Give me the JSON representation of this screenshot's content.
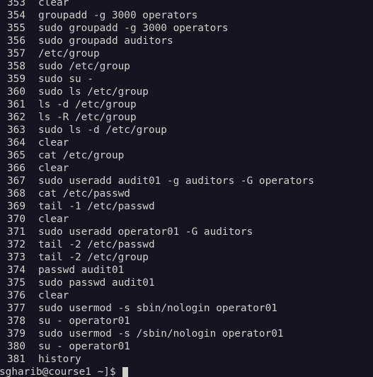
{
  "terminal": {
    "history": [
      {
        "num": "353",
        "cmd": "clear"
      },
      {
        "num": "354",
        "cmd": "groupadd -g 3000 operators"
      },
      {
        "num": "355",
        "cmd": "sudo groupadd -g 3000 operators"
      },
      {
        "num": "356",
        "cmd": "sudo groupadd auditors"
      },
      {
        "num": "357",
        "cmd": "/etc/group"
      },
      {
        "num": "358",
        "cmd": "sudo /etc/group"
      },
      {
        "num": "359",
        "cmd": "sudo su -"
      },
      {
        "num": "360",
        "cmd": "sudo ls /etc/group"
      },
      {
        "num": "361",
        "cmd": "ls -d /etc/group"
      },
      {
        "num": "362",
        "cmd": "ls -R /etc/group"
      },
      {
        "num": "363",
        "cmd": "sudo ls -d /etc/group"
      },
      {
        "num": "364",
        "cmd": "clear"
      },
      {
        "num": "365",
        "cmd": "cat /etc/group"
      },
      {
        "num": "366",
        "cmd": "clear"
      },
      {
        "num": "367",
        "cmd": "sudo useradd audit01 -g auditors -G operators"
      },
      {
        "num": "368",
        "cmd": "cat /etc/passwd"
      },
      {
        "num": "369",
        "cmd": "tail -1 /etc/passwd"
      },
      {
        "num": "370",
        "cmd": "clear"
      },
      {
        "num": "371",
        "cmd": "sudo useradd operator01 -G auditors"
      },
      {
        "num": "372",
        "cmd": "tail -2 /etc/passwd"
      },
      {
        "num": "373",
        "cmd": "tail -2 /etc/group"
      },
      {
        "num": "374",
        "cmd": "passwd audit01"
      },
      {
        "num": "375",
        "cmd": "sudo passwd audit01"
      },
      {
        "num": "376",
        "cmd": "clear"
      },
      {
        "num": "377",
        "cmd": "sudo usermod -s sbin/nologin operator01"
      },
      {
        "num": "378",
        "cmd": "su - operator01"
      },
      {
        "num": "379",
        "cmd": "sudo usermod -s /sbin/nologin operator01"
      },
      {
        "num": "380",
        "cmd": "su - operator01"
      },
      {
        "num": "381",
        "cmd": "history"
      }
    ],
    "prompt": "sgharib@course1 ~]$",
    "colors": {
      "background": "#171421",
      "foreground": "#d0cfcc"
    }
  }
}
